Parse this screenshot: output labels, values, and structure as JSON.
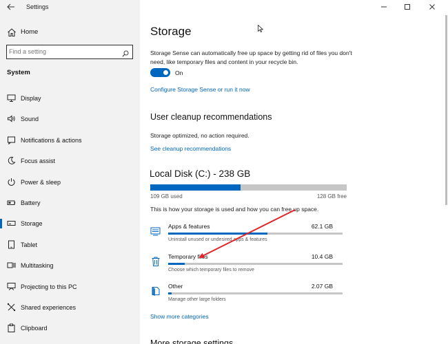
{
  "window": {
    "app_title": "Settings",
    "controls": [
      "minimize-icon",
      "maximize-icon",
      "close-icon"
    ]
  },
  "sidebar": {
    "home_label": "Home",
    "search_placeholder": "Find a setting",
    "section_label": "System",
    "items": [
      {
        "label": "Display",
        "icon": "display-icon"
      },
      {
        "label": "Sound",
        "icon": "sound-icon"
      },
      {
        "label": "Notifications & actions",
        "icon": "notifications-icon"
      },
      {
        "label": "Focus assist",
        "icon": "focus-assist-icon"
      },
      {
        "label": "Power & sleep",
        "icon": "power-icon"
      },
      {
        "label": "Battery",
        "icon": "battery-icon"
      },
      {
        "label": "Storage",
        "icon": "storage-icon",
        "active": true
      },
      {
        "label": "Tablet",
        "icon": "tablet-icon"
      },
      {
        "label": "Multitasking",
        "icon": "multitasking-icon"
      },
      {
        "label": "Projecting to this PC",
        "icon": "projecting-icon"
      },
      {
        "label": "Shared experiences",
        "icon": "shared-experiences-icon"
      },
      {
        "label": "Clipboard",
        "icon": "clipboard-icon"
      }
    ]
  },
  "main": {
    "title": "Storage",
    "storage_sense": {
      "description": "Storage Sense can automatically free up space by getting rid of files you don't need, like temporary files and content in your recycle bin.",
      "toggle_state": "On",
      "configure_link": "Configure Storage Sense or run it now"
    },
    "cleanup": {
      "title": "User cleanup recommendations",
      "status": "Storage optimized, no action required.",
      "link": "See cleanup recommendations"
    },
    "disk": {
      "title": "Local Disk (C:) - 238 GB",
      "used_label": "109 GB used",
      "free_label": "128 GB free",
      "used_fraction": 0.46,
      "description": "This is how your storage is used and how you can free up space."
    },
    "categories": [
      {
        "name": "Apps & features",
        "size": "62.1 GB",
        "sub": "Uninstall unused or undesired apps & features",
        "fraction": 0.57,
        "icon": "apps-icon"
      },
      {
        "name": "Temporary files",
        "size": "10.4 GB",
        "sub": "Choose which temporary files to remove",
        "fraction": 0.095,
        "icon": "trash-icon"
      },
      {
        "name": "Other",
        "size": "2.07 GB",
        "sub": "Manage other large folders",
        "fraction": 0.02,
        "icon": "other-icon"
      }
    ],
    "more_categories_link": "Show more categories",
    "more_settings_title": "More storage settings"
  },
  "colors": {
    "accent": "#0067c0",
    "sidebar_bg": "#f2f2f2",
    "bar_track": "#c6c6c6",
    "annotation_arrow": "#e0252b"
  }
}
